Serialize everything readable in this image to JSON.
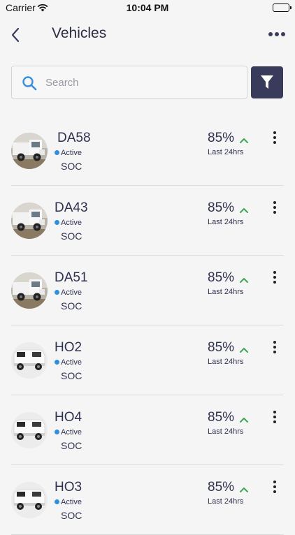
{
  "status_bar": {
    "carrier": "Carrier",
    "time": "10:04 PM"
  },
  "header": {
    "title": "Vehicles",
    "back_icon": "chevron-left-icon",
    "more_icon": "more-horizontal-icon"
  },
  "search": {
    "placeholder": "Search",
    "icon": "search-icon"
  },
  "filter": {
    "icon": "filter-icon",
    "accent": "#383b5a"
  },
  "colors": {
    "active_dot": "#2e8fe0",
    "trend_up": "#3aa655"
  },
  "vehicles": [
    {
      "name": "DA58",
      "status": "Active",
      "metric": "SOC",
      "percent": "85%",
      "period": "Last 24hrs",
      "type": "truck"
    },
    {
      "name": "DA43",
      "status": "Active",
      "metric": "SOC",
      "percent": "85%",
      "period": "Last 24hrs",
      "type": "truck"
    },
    {
      "name": "DA51",
      "status": "Active",
      "metric": "SOC",
      "percent": "85%",
      "period": "Last 24hrs",
      "type": "truck"
    },
    {
      "name": "HO2",
      "status": "Active",
      "metric": "SOC",
      "percent": "85%",
      "period": "Last 24hrs",
      "type": "van"
    },
    {
      "name": "HO4",
      "status": "Active",
      "metric": "SOC",
      "percent": "85%",
      "period": "Last 24hrs",
      "type": "van"
    },
    {
      "name": "HO3",
      "status": "Active",
      "metric": "SOC",
      "percent": "85%",
      "period": "Last 24hrs",
      "type": "van"
    }
  ]
}
